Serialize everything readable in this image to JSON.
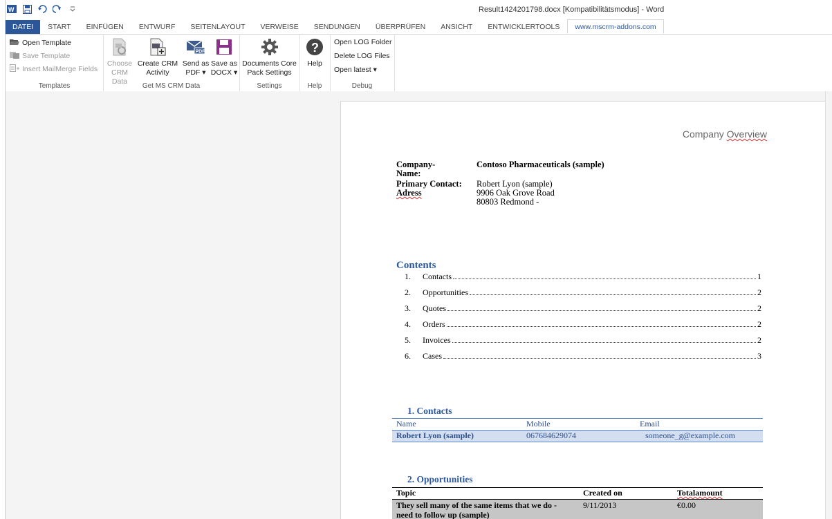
{
  "window": {
    "title": "Result1424201798.docx [Kompatibilitätsmodus] - Word"
  },
  "tabs": [
    "DATEI",
    "START",
    "EINFÜGEN",
    "ENTWURF",
    "SEITENLAYOUT",
    "VERWEISE",
    "SENDUNGEN",
    "ÜBERPRÜFEN",
    "ANSICHT",
    "ENTWICKLERTOOLS",
    "www.mscrm-addons.com"
  ],
  "ribbon": {
    "templates": {
      "open": "Open Template",
      "save": "Save Template",
      "insert": "Insert MailMerge Fields",
      "label": "Templates"
    },
    "crm": {
      "choose": [
        "Choose",
        "CRM Data"
      ],
      "create": [
        "Create CRM",
        "Activity"
      ],
      "send": [
        "Send as",
        "PDF ▾"
      ],
      "saveas": [
        "Save as",
        "DOCX ▾"
      ],
      "label": "Get MS CRM Data"
    },
    "settings": {
      "btn": [
        "Documents Core",
        "Pack Settings"
      ],
      "label": "Settings"
    },
    "help": {
      "btn": "Help",
      "label": "Help"
    },
    "debug": {
      "open_folder": "Open LOG Folder",
      "delete": "Delete LOG Files",
      "latest": "Open latest ▾",
      "label": "Debug"
    }
  },
  "doc": {
    "header_title": {
      "a": "Company ",
      "b": "Overview"
    },
    "company_label": [
      "Company-",
      "Name:"
    ],
    "company_value": "Contoso Pharmaceuticals (sample)",
    "contact_label": "Primary Contact:",
    "contact_value": "Robert Lyon (sample)",
    "address_label": "Adress",
    "address_lines": [
      "9906 Oak Grove Road",
      "80803 Redmond -"
    ],
    "contents_title": "Contents",
    "toc": [
      {
        "n": "1.",
        "t": "Contacts",
        "p": "1"
      },
      {
        "n": "2.",
        "t": "Opportunities",
        "p": "2"
      },
      {
        "n": "3.",
        "t": "Quotes",
        "p": "2"
      },
      {
        "n": "4.",
        "t": "Orders",
        "p": "2"
      },
      {
        "n": "5.",
        "t": "Invoices",
        "p": "2"
      },
      {
        "n": "6.",
        "t": "Cases",
        "p": "3"
      }
    ],
    "contacts": {
      "title": "1.  Contacts",
      "headers": [
        "Name",
        "Mobile",
        "Email"
      ],
      "row": [
        "Robert Lyon (sample)",
        "067684629074",
        "someone_g@example.com"
      ]
    },
    "opportunities": {
      "title": "2.  Opportunities",
      "headers": [
        "Topic",
        "Created on",
        "Totalamount"
      ],
      "row": [
        "They sell many of the same items that we do -",
        "need to follow up (sample)",
        "9/11/2013",
        "€0.00"
      ]
    }
  }
}
